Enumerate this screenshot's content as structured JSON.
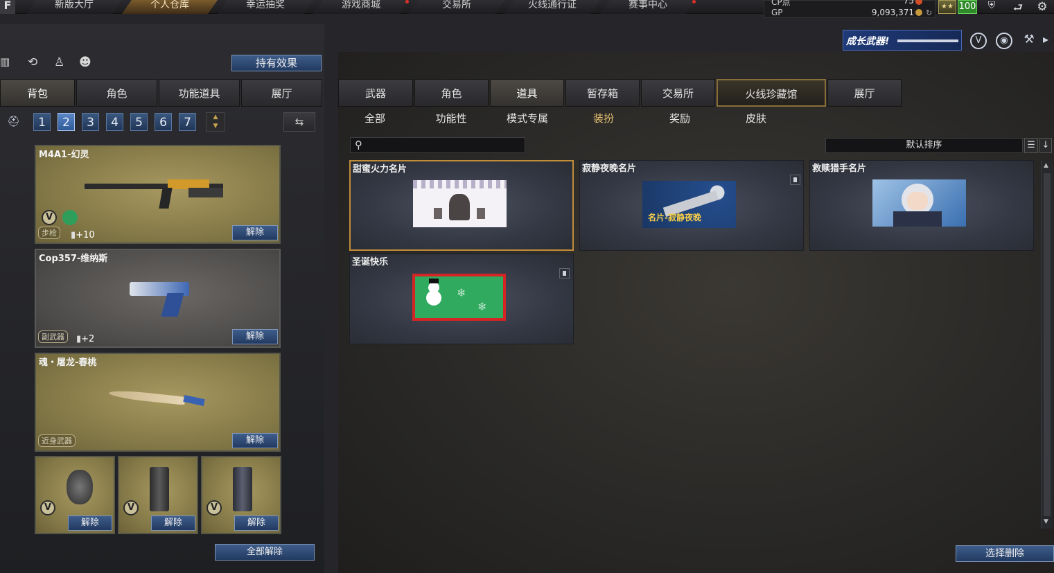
{
  "nav": {
    "logo": "F",
    "tabs": [
      "新版大厅",
      "个人仓库",
      "幸运抽奖",
      "游戏商城",
      "交易所",
      "火线通行证",
      "赛事中心"
    ],
    "active_index": 1
  },
  "currency": {
    "cp_label": "CP点",
    "cp_value": "75",
    "gp_label": "GP",
    "gp_value": "9,093,371",
    "level_value": "100"
  },
  "banner": {
    "text": "成长武器!"
  },
  "left": {
    "effects_button": "持有效果",
    "tabs": [
      "背包",
      "角色",
      "功能道具",
      "展厅"
    ],
    "pages": [
      "1",
      "2",
      "3",
      "4",
      "5",
      "6",
      "7"
    ],
    "active_page": "2",
    "weapons": [
      {
        "name": "M4A1-幻灵",
        "type": "步枪",
        "plus": "+10",
        "action": "解除",
        "badge": "V"
      },
      {
        "name": "Cop357-维纳斯",
        "type": "副武器",
        "plus": "+2",
        "action": "解除"
      },
      {
        "name": "魂・屠龙-春桃",
        "type": "近身武器",
        "action": "解除"
      }
    ],
    "grenades": [
      {
        "badge": "V",
        "action": "解除"
      },
      {
        "badge": "V",
        "action": "解除"
      },
      {
        "badge": "V",
        "action": "解除"
      }
    ],
    "unequip_all": "全部解除"
  },
  "right": {
    "tabs": [
      "武器",
      "角色",
      "道具",
      "暂存箱",
      "交易所",
      "火线珍藏馆",
      "展厅"
    ],
    "active_tab": "道具",
    "special_tab": "火线珍藏馆",
    "subtabs": [
      "全部",
      "功能性",
      "模式专属",
      "装扮",
      "奖励",
      "皮肤"
    ],
    "active_subtab": "装扮",
    "search": {
      "placeholder": ""
    },
    "sort_label": "默认排序",
    "items": [
      {
        "title": "甜蜜火力名片",
        "selected": true
      },
      {
        "title": "寂静夜晚名片",
        "thumb_text": "名片-寂静夜晚",
        "deletable": true
      },
      {
        "title": "救赎猎手名片"
      },
      {
        "title": "圣诞快乐",
        "deletable": true
      }
    ],
    "bulk_delete": "选择删除"
  },
  "colors": {
    "accent_gold": "#c28d38",
    "blue_button": "#2f4c78",
    "active_page": "#4a78b8"
  }
}
